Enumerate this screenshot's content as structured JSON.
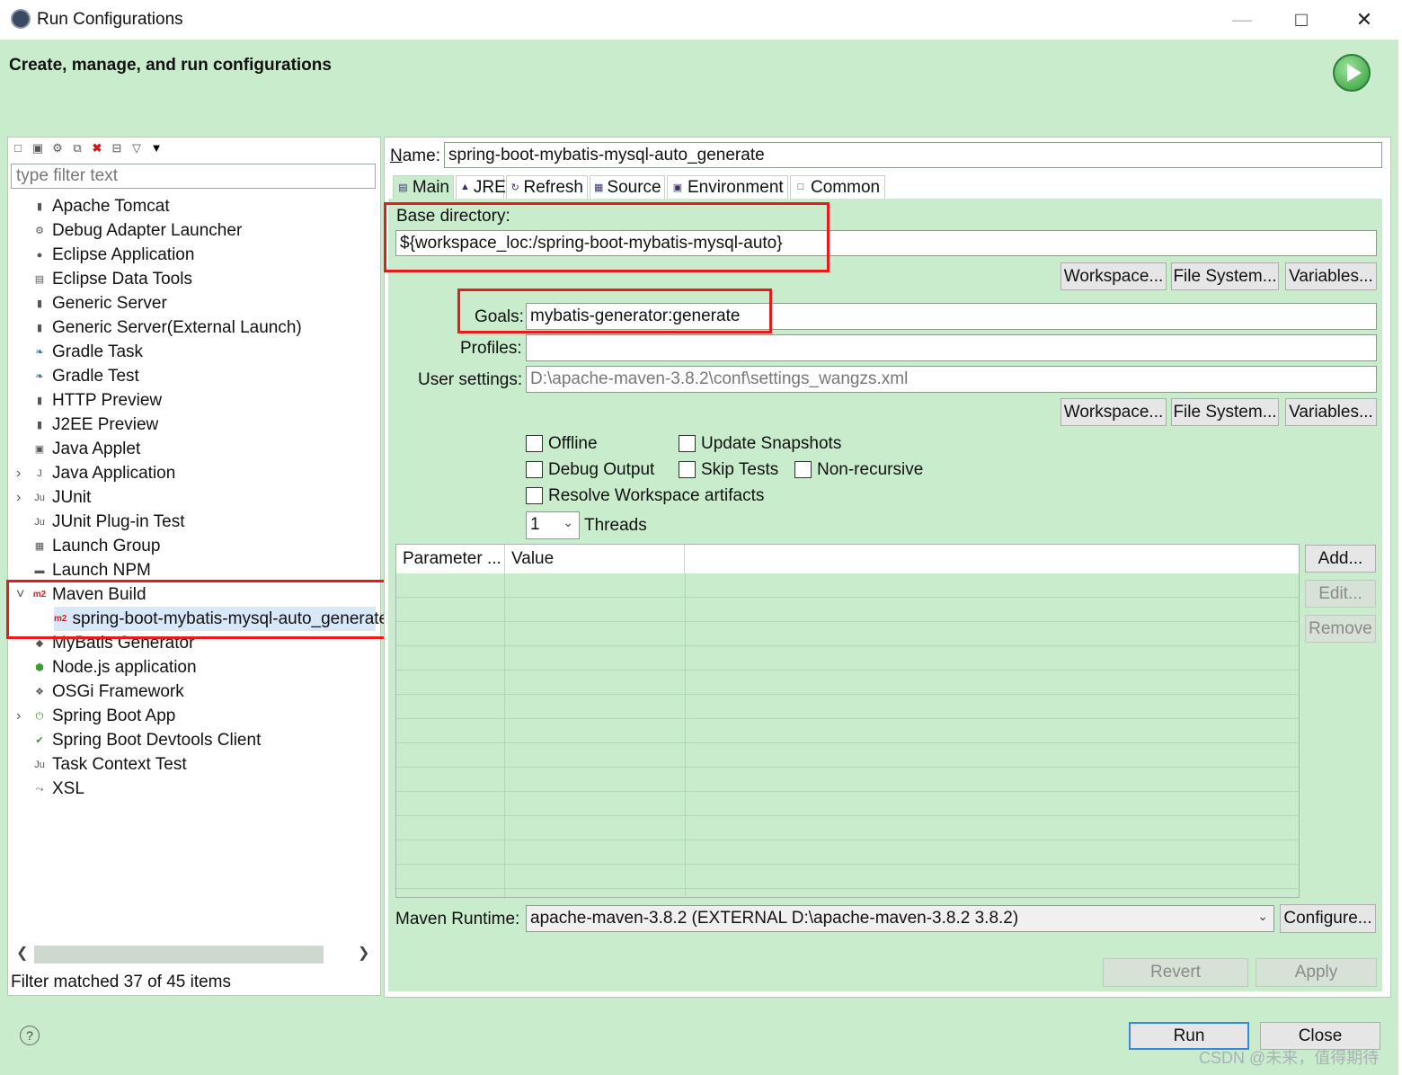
{
  "window": {
    "title": "Run Configurations",
    "minimize": "—",
    "maximize": "□",
    "close": "✕"
  },
  "header": {
    "title": "Create, manage, and run configurations"
  },
  "left": {
    "filter_placeholder": "type filter text",
    "items": [
      {
        "label": "Apache Tomcat",
        "icon": "server-icon",
        "glyph": "▮"
      },
      {
        "label": "Debug Adapter Launcher",
        "icon": "debug-icon",
        "glyph": "⚙"
      },
      {
        "label": "Eclipse Application",
        "icon": "eclipse-icon",
        "glyph": "●"
      },
      {
        "label": "Eclipse Data Tools",
        "icon": "database-icon",
        "glyph": "▤"
      },
      {
        "label": "Generic Server",
        "icon": "server-icon",
        "glyph": "▮"
      },
      {
        "label": "Generic Server(External Launch)",
        "icon": "server-icon",
        "glyph": "▮"
      },
      {
        "label": "Gradle Task",
        "icon": "gradle-icon",
        "glyph": "❧"
      },
      {
        "label": "Gradle Test",
        "icon": "gradle-icon",
        "glyph": "❧"
      },
      {
        "label": "HTTP Preview",
        "icon": "server-icon",
        "glyph": "▮"
      },
      {
        "label": "J2EE Preview",
        "icon": "server-icon",
        "glyph": "▮"
      },
      {
        "label": "Java Applet",
        "icon": "applet-icon",
        "glyph": "▣"
      },
      {
        "label": "Java Application",
        "icon": "java-app-icon",
        "glyph": "J"
      },
      {
        "label": "JUnit",
        "icon": "junit-icon",
        "glyph": "Ju"
      },
      {
        "label": "JUnit Plug-in Test",
        "icon": "junit-plugin-icon",
        "glyph": "Ju"
      },
      {
        "label": "Launch Group",
        "icon": "launch-group-icon",
        "glyph": "▦"
      },
      {
        "label": "Launch NPM",
        "icon": "npm-icon",
        "glyph": "▬"
      },
      {
        "label": "Maven Build",
        "icon": "maven-icon",
        "glyph": "m2"
      },
      {
        "label": "spring-boot-mybatis-mysql-auto_generate",
        "icon": "maven-icon",
        "glyph": "m2"
      },
      {
        "label": "MyBatis Generator",
        "icon": "mybatis-icon",
        "glyph": "◆"
      },
      {
        "label": "Node.js application",
        "icon": "nodejs-icon",
        "glyph": "⬢"
      },
      {
        "label": "OSGi Framework",
        "icon": "osgi-icon",
        "glyph": "❖"
      },
      {
        "label": "Spring Boot App",
        "icon": "spring-boot-icon",
        "glyph": "⏻"
      },
      {
        "label": "Spring Boot Devtools Client",
        "icon": "spring-devtools-icon",
        "glyph": "✔"
      },
      {
        "label": "Task Context Test",
        "icon": "task-test-icon",
        "glyph": "Ju"
      },
      {
        "label": "XSL",
        "icon": "xsl-icon",
        "glyph": "⤳"
      }
    ],
    "status": "Filter matched 37 of 45 items"
  },
  "right": {
    "name_label": "Name:",
    "name_value": "spring-boot-mybatis-mysql-auto_generate",
    "tabs": [
      "Main",
      "JRE",
      "Refresh",
      "Source",
      "Environment",
      "Common"
    ],
    "base_dir_label": "Base directory:",
    "base_dir_value": "${workspace_loc:/spring-boot-mybatis-mysql-auto}",
    "workspace_btn": "Workspace...",
    "filesystem_btn": "File System...",
    "variables_btn": "Variables...",
    "goals_label": "Goals:",
    "goals_value": "mybatis-generator:generate",
    "profiles_label": "Profiles:",
    "profiles_value": "",
    "user_settings_label": "User settings:",
    "user_settings_value": "D:\\apache-maven-3.8.2\\conf\\settings_wangzs.xml",
    "checkboxes": {
      "offline": "Offline",
      "update_snapshots": "Update Snapshots",
      "debug_output": "Debug Output",
      "skip_tests": "Skip Tests",
      "non_recursive": "Non-recursive",
      "resolve_workspace": "Resolve Workspace artifacts"
    },
    "threads_value": "1",
    "threads_label": "Threads",
    "table_headers": [
      "Parameter ...",
      "Value"
    ],
    "add_btn": "Add...",
    "edit_btn": "Edit...",
    "remove_btn": "Remove",
    "runtime_label": "Maven Runtime:",
    "runtime_value": "apache-maven-3.8.2 (EXTERNAL D:\\apache-maven-3.8.2 3.8.2)",
    "configure_btn": "Configure...",
    "revert_btn": "Revert",
    "apply_btn": "Apply"
  },
  "footer": {
    "help": "?",
    "run_btn": "Run",
    "close_btn": "Close",
    "watermark": "CSDN @未来，值得期待"
  }
}
